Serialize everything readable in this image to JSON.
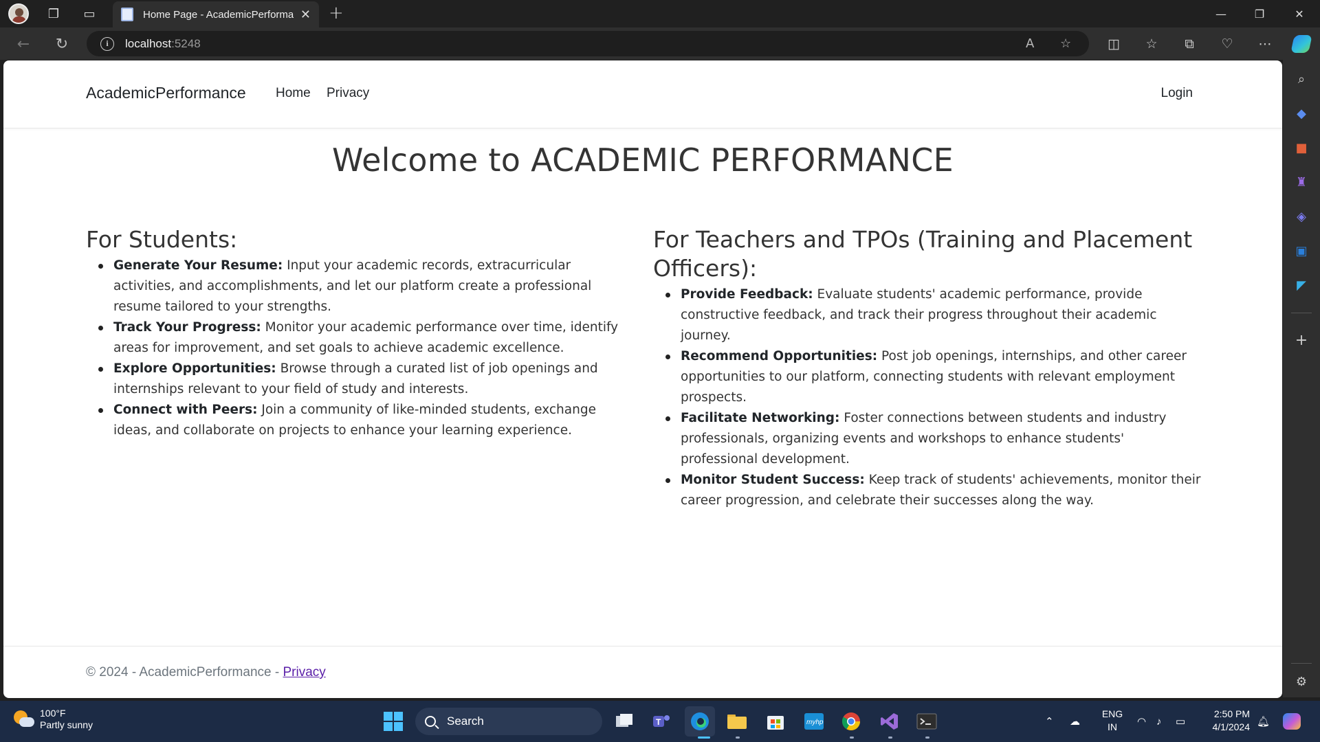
{
  "browser": {
    "tab_title": "Home Page - AcademicPerformance",
    "url_host": "localhost",
    "url_port": ":5248"
  },
  "site": {
    "brand": "AcademicPerformance",
    "nav": {
      "home": "Home",
      "privacy": "Privacy",
      "login": "Login"
    },
    "welcome": "Welcome to ACADEMIC PERFORMANCE",
    "students": {
      "heading": "For Students:",
      "items": [
        {
          "title": "Generate Your Resume:",
          "text": " Input your academic records, extracurricular activities, and accomplishments, and let our platform create a professional resume tailored to your strengths."
        },
        {
          "title": "Track Your Progress:",
          "text": " Monitor your academic performance over time, identify areas for improvement, and set goals to achieve academic excellence."
        },
        {
          "title": "Explore Opportunities:",
          "text": " Browse through a curated list of job openings and internships relevant to your field of study and interests."
        },
        {
          "title": "Connect with Peers:",
          "text": " Join a community of like-minded students, exchange ideas, and collaborate on projects to enhance your learning experience."
        }
      ]
    },
    "teachers": {
      "heading": "For Teachers and TPOs (Training and Placement Officers):",
      "items": [
        {
          "title": "Provide Feedback:",
          "text": " Evaluate students' academic performance, provide constructive feedback, and track their progress throughout their academic journey."
        },
        {
          "title": "Recommend Opportunities:",
          "text": " Post job openings, internships, and other career opportunities to our platform, connecting students with relevant employment prospects."
        },
        {
          "title": "Facilitate Networking:",
          "text": " Foster connections between students and industry professionals, organizing events and workshops to enhance students' professional development."
        },
        {
          "title": "Monitor Student Success:",
          "text": " Keep track of students' achievements, monitor their career progression, and celebrate their successes along the way."
        }
      ]
    },
    "footer": {
      "text": "© 2024 - AcademicPerformance - ",
      "link": "Privacy"
    }
  },
  "taskbar": {
    "weather_temp": "100°F",
    "weather_desc": "Partly sunny",
    "search": "Search",
    "lang_1": "ENG",
    "lang_2": "IN",
    "time": "2:50 PM",
    "date": "4/1/2024"
  }
}
